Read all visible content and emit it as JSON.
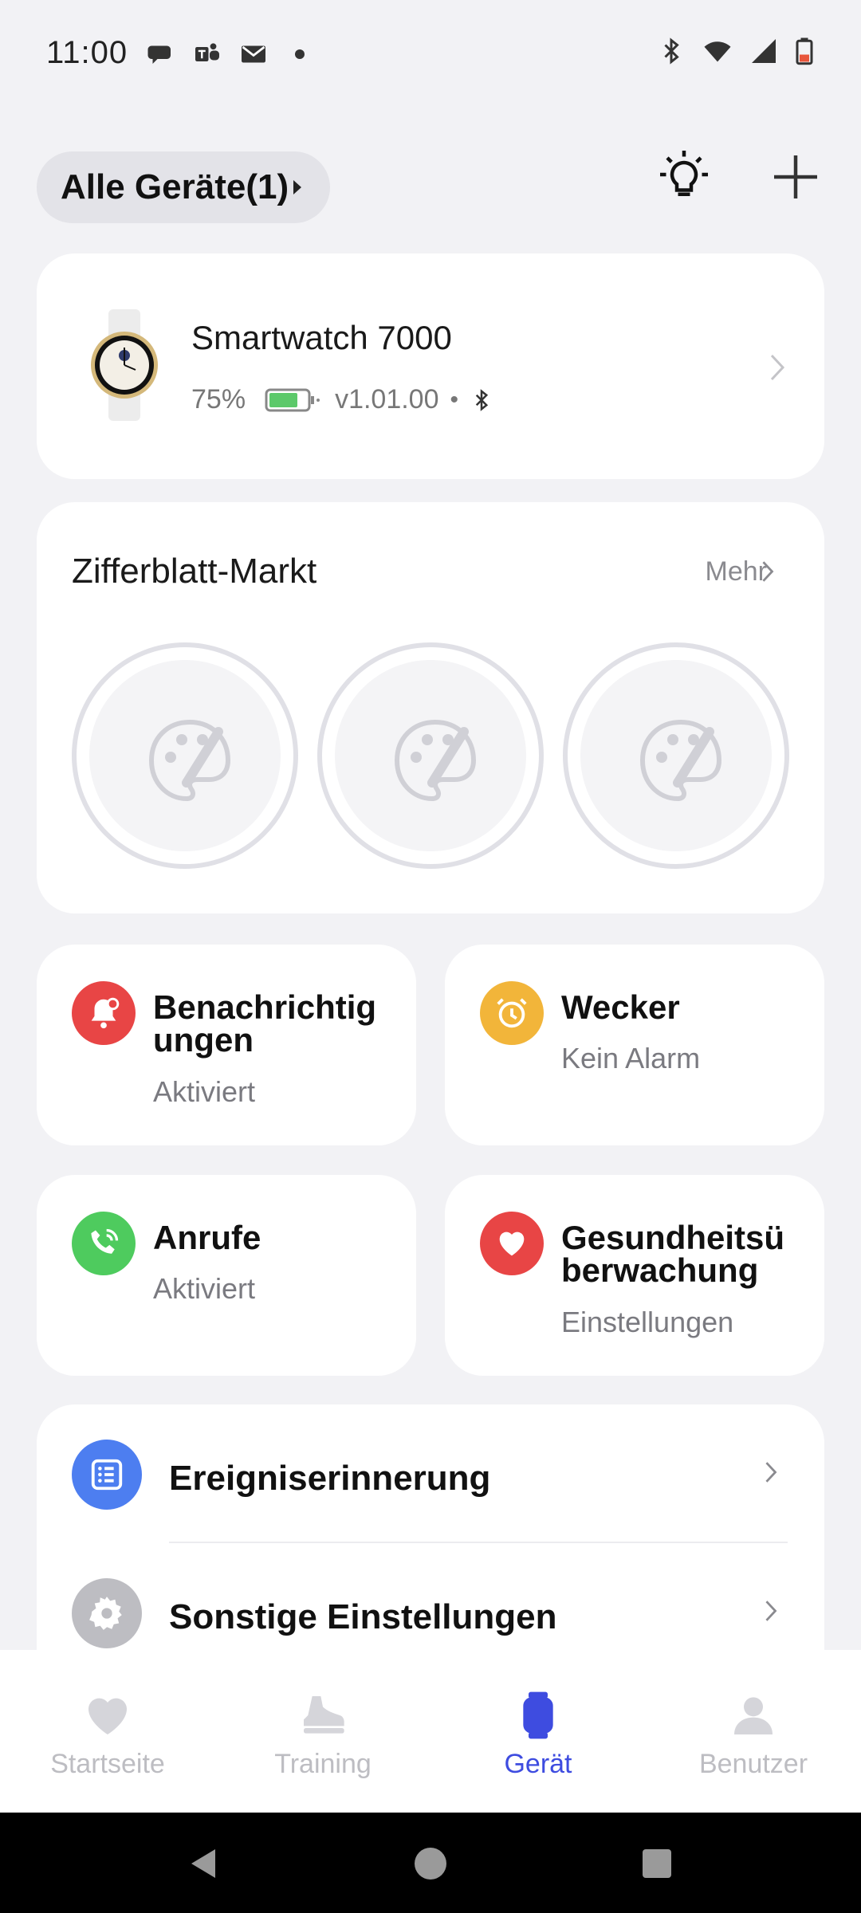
{
  "status_bar": {
    "time": "11:00",
    "left_icons": [
      "chat-bubble-icon",
      "teams-icon",
      "mail-icon",
      "dot-icon"
    ],
    "right_icons": [
      "bluetooth-icon",
      "wifi-icon",
      "signal-icon",
      "battery-low-icon"
    ]
  },
  "header": {
    "devices_label": "Alle Geräte(1)",
    "icons": [
      "lightbulb-icon",
      "plus-icon"
    ]
  },
  "device": {
    "name": "Smartwatch 7000",
    "battery_percent": "75%",
    "battery_level": 0.75,
    "version": "v1.01.00",
    "battery_color": "#5CC96A"
  },
  "market": {
    "title": "Zifferblatt-Markt",
    "more": "Mehr",
    "faces": [
      {
        "name": "watch-face-placeholder-1"
      },
      {
        "name": "watch-face-placeholder-2"
      },
      {
        "name": "watch-face-placeholder-3"
      }
    ]
  },
  "tiles": {
    "notifications": {
      "title": "Benachrichtig\nungen",
      "title_line1": "Benachrichtig",
      "title_line2": "ungen",
      "subtitle": "Aktiviert",
      "color": "#E84545"
    },
    "alarm": {
      "title": "Wecker",
      "subtitle": "Kein Alarm",
      "color": "#F2B53A"
    },
    "calls": {
      "title": "Anrufe",
      "subtitle": "Aktiviert",
      "color": "#4ECB5E"
    },
    "health": {
      "title_line1": "Gesundheitsü",
      "title_line2": "berwachung",
      "subtitle": "Einstellungen",
      "color": "#E84545"
    }
  },
  "list": {
    "items": [
      {
        "label": "Ereigniserinnerung",
        "color": "#4D7EF0"
      },
      {
        "label": "Sonstige Einstellungen",
        "color": "#BDBDC2"
      }
    ]
  },
  "bottom_nav": {
    "items": [
      {
        "label": "Startseite",
        "icon": "heart-icon"
      },
      {
        "label": "Training",
        "icon": "shoe-icon"
      },
      {
        "label": "Gerät",
        "icon": "watch-icon",
        "active": true
      },
      {
        "label": "Benutzer",
        "icon": "user-icon"
      }
    ],
    "active_color": "#3E4CE0",
    "inactive_color": "#BDBDC2"
  }
}
